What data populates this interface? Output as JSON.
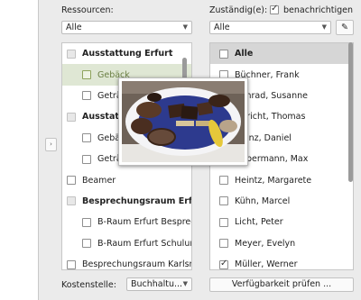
{
  "resources": {
    "label": "Ressourcen:",
    "filter_value": "Alle",
    "items": [
      {
        "label": "Ausstattung Erfurt",
        "kind": "group",
        "indent": 0
      },
      {
        "label": "Gebäck",
        "kind": "item",
        "indent": 1,
        "selected": true
      },
      {
        "label": "Getränke",
        "kind": "item",
        "indent": 1
      },
      {
        "label": "Ausstattung Schulungsraum",
        "kind": "group",
        "indent": 0
      },
      {
        "label": "Gebäck",
        "kind": "item",
        "indent": 1
      },
      {
        "label": "Getränke",
        "kind": "item",
        "indent": 1
      },
      {
        "label": "Beamer",
        "kind": "item",
        "indent": 0
      },
      {
        "label": "Besprechungsraum Erfurt",
        "kind": "group",
        "indent": 0
      },
      {
        "label": "B-Raum Erfurt Besprechung",
        "kind": "item",
        "indent": 1
      },
      {
        "label": "B-Raum Erfurt Schulung",
        "kind": "item",
        "indent": 1
      },
      {
        "label": "Besprechungsraum Karlsruhe",
        "kind": "item",
        "indent": 0
      }
    ]
  },
  "assignees": {
    "label": "Zuständig(e):",
    "notify_label": "benachrichtigen",
    "notify_checked": true,
    "filter_value": "Alle",
    "items": [
      {
        "label": "Alle",
        "head": true,
        "checked": false
      },
      {
        "label": "Büchner, Frank",
        "checked": false
      },
      {
        "label": "Conrad, Susanne",
        "checked": false
      },
      {
        "label": "Gericht, Thomas",
        "checked": false
      },
      {
        "label": "Hainz, Daniel",
        "checked": false
      },
      {
        "label": "Habermann, Max",
        "checked": false
      },
      {
        "label": "Heintz, Margarete",
        "checked": false
      },
      {
        "label": "Kühn, Marcel",
        "checked": false
      },
      {
        "label": "Licht, Peter",
        "checked": false
      },
      {
        "label": "Meyer, Evelyn",
        "checked": false
      },
      {
        "label": "Müller, Werner",
        "checked": true
      }
    ]
  },
  "footer": {
    "cost_center_label": "Kostenstelle:",
    "cost_center_value": "Buchhaltu...",
    "check_button": "Verfügbarkeit prüfen ..."
  },
  "icons": {
    "collapse": "chevron-right-icon",
    "edit": "pencil-icon",
    "dropdown": "chevron-down-icon",
    "preview": "cookie-plate-photo"
  },
  "colors": {
    "selection": "#dfe7d4",
    "header_row": "#d6d6d6"
  }
}
